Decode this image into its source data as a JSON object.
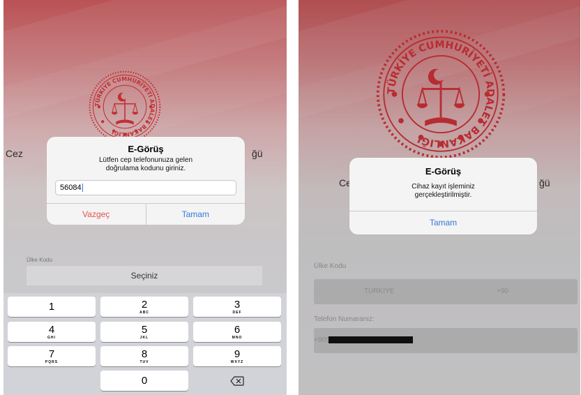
{
  "left_screen": {
    "behind_title_left": "Cez",
    "behind_title_right": "ğü",
    "alert": {
      "title": "E-Görüş",
      "message_line1": "Lütfen cep telefonunuza gelen",
      "message_line2": "doğrulama kodunu giriniz.",
      "input_value": "56084",
      "cancel_label": "Vazgeç",
      "ok_label": "Tamam"
    },
    "country_code_label": "Ülke Kodu",
    "country_select_value": "Seçiniz",
    "keypad": [
      {
        "num": "1",
        "letters": ""
      },
      {
        "num": "2",
        "letters": "ABC"
      },
      {
        "num": "3",
        "letters": "DEF"
      },
      {
        "num": "4",
        "letters": "GHI"
      },
      {
        "num": "5",
        "letters": "JKL"
      },
      {
        "num": "6",
        "letters": "MNO"
      },
      {
        "num": "7",
        "letters": "PQRS"
      },
      {
        "num": "8",
        "letters": "TUV"
      },
      {
        "num": "9",
        "letters": "WXYZ"
      },
      {
        "num": "0",
        "letters": ""
      }
    ]
  },
  "right_screen": {
    "behind_title_left": "Ce",
    "behind_title_right": "ğü",
    "alert": {
      "title": "E-Görüş",
      "message_line1": "Cihaz kayıt işleminiz",
      "message_line2": "gerçekleştirilmiştir.",
      "ok_label": "Tamam"
    },
    "country_code_label": "Ülke Kodu",
    "country_name": "TURKIYE",
    "country_dial": "+90",
    "phone_label": "Telefon Numaranız:",
    "phone_prefix": "+905"
  },
  "emblem_text": "TÜRKİYE CUMHURİYETİ ADALET BAKANLIĞI",
  "colors": {
    "emblem_red": "#d8262d",
    "ios_blue": "#3279d6",
    "ios_red": "#e0524c"
  }
}
